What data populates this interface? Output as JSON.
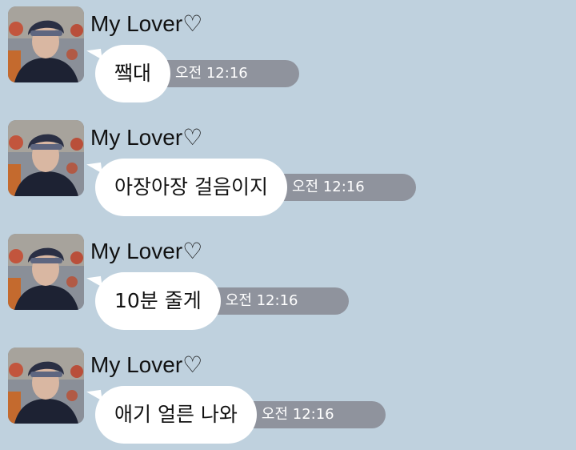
{
  "chat": {
    "messages": [
      {
        "sender": "My Lover♡",
        "text": "쨐대",
        "time": "오전 12:16"
      },
      {
        "sender": "My Lover♡",
        "text": "아장아장 걸음이지",
        "time": "오전 12:16"
      },
      {
        "sender": "My Lover♡",
        "text": "10분 줄게",
        "time": "오전 12:16"
      },
      {
        "sender": "My Lover♡",
        "text": "애기 얼른 나와",
        "time": "오전 12:16"
      }
    ]
  },
  "colors": {
    "background": "#bfd1de",
    "bubble": "#ffffff",
    "time_pill": "#8f939d"
  },
  "icons": {
    "avatar": "profile-photo-avatar"
  }
}
